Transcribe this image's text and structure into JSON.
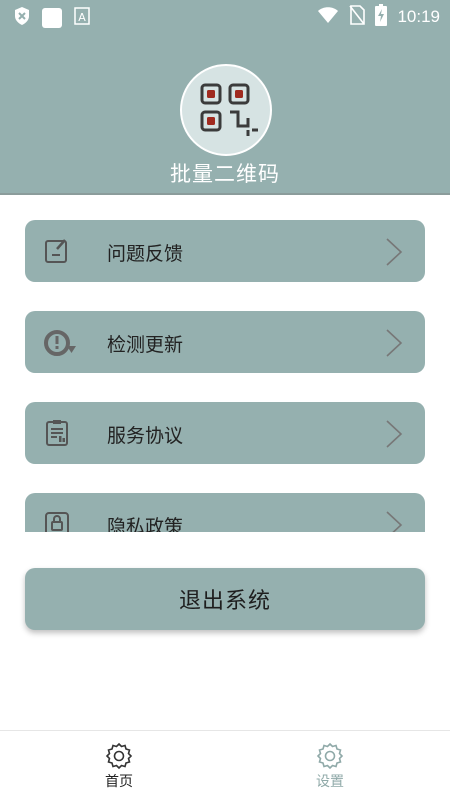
{
  "status_bar": {
    "time": "10:19",
    "left_icons": [
      "shield-x-icon",
      "app-square-icon",
      "font-a-icon"
    ],
    "right_icons": [
      "wifi-icon",
      "no-sim-icon",
      "battery-charging-icon"
    ]
  },
  "header": {
    "app_title": "批量二维码",
    "avatar_icon": "qr-code-icon",
    "background": "#95b0af"
  },
  "menu": {
    "items": [
      {
        "label": "问题反馈",
        "icon": "feedback-edit-icon"
      },
      {
        "label": "检测更新",
        "icon": "update-refresh-icon"
      },
      {
        "label": "服务协议",
        "icon": "clipboard-doc-icon"
      },
      {
        "label": "隐私政策",
        "icon": "privacy-lock-icon"
      }
    ]
  },
  "logout_button": {
    "label": "退出系统"
  },
  "bottom_nav": {
    "tabs": [
      {
        "label": "首页",
        "icon": "gear-icon",
        "color": "#222222"
      },
      {
        "label": "设置",
        "icon": "gear-icon",
        "color": "#8fa9a8",
        "active": true
      }
    ]
  }
}
